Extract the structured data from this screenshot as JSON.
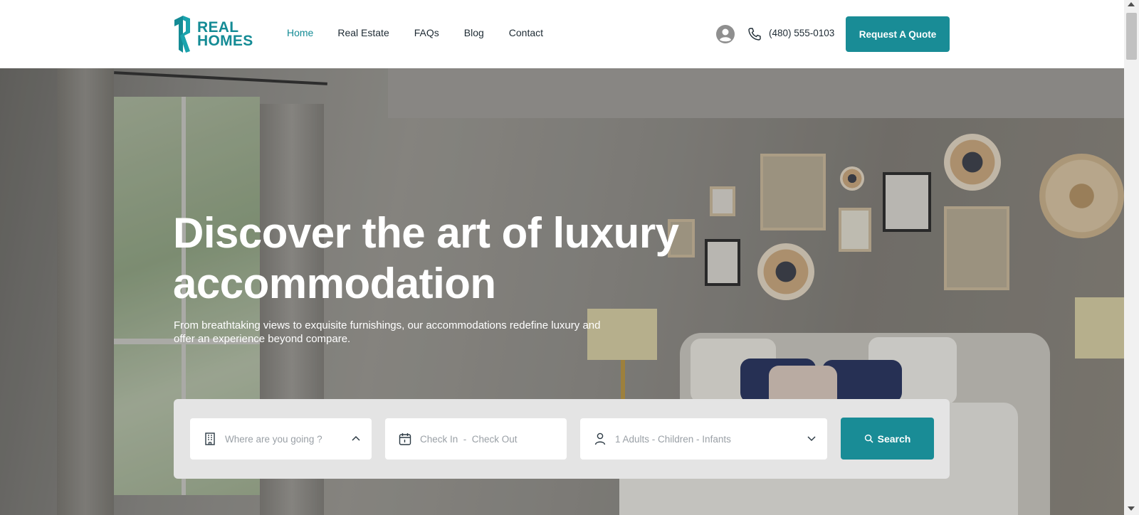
{
  "header": {
    "logo": {
      "line1": "REAL",
      "line2": "HOMES"
    },
    "nav": [
      {
        "label": "Home",
        "active": true
      },
      {
        "label": "Real Estate",
        "active": false
      },
      {
        "label": "FAQs",
        "active": false
      },
      {
        "label": "Blog",
        "active": false
      },
      {
        "label": "Contact",
        "active": false
      }
    ],
    "phone": "(480) 555-0103",
    "quote_button": "Request A Quote",
    "icons": {
      "account": "user-circle-icon",
      "phone": "phone-icon"
    }
  },
  "hero": {
    "title_line1": "Discover the art of luxury",
    "title_line2": "accommodation",
    "subtitle": "From breathtaking views to exquisite furnishings, our accommodations redefine luxury and offer an experience beyond compare."
  },
  "search": {
    "destination_placeholder": "Where are you going ?",
    "dates_placeholder": "Check In  -  Check Out",
    "guests_placeholder": "1 Adults - Children - Infants",
    "button_label": "Search",
    "icons": {
      "destination": "building-icon",
      "dates": "calendar-icon",
      "guests": "person-icon",
      "button": "search-icon"
    }
  },
  "colors": {
    "accent": "#198c96",
    "logo": "#148b95",
    "panel": "#e4e4e4"
  }
}
